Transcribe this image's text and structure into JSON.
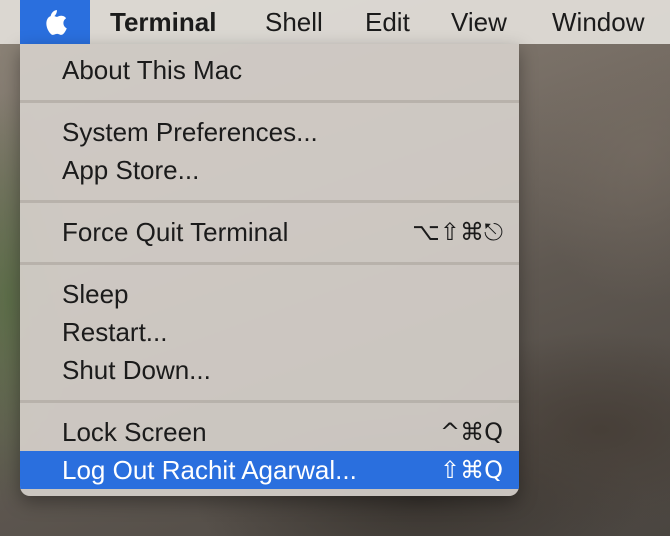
{
  "menubar": {
    "apple_icon": "apple-logo-icon",
    "app_name": "Terminal",
    "menus": [
      "Shell",
      "Edit",
      "View",
      "Window"
    ]
  },
  "apple_menu": {
    "items": {
      "about": "About This Mac",
      "system_preferences": "System Preferences...",
      "app_store": "App Store...",
      "force_quit": "Force Quit Terminal",
      "force_quit_shortcut": "⌥⇧⌘⎋",
      "sleep": "Sleep",
      "restart": "Restart...",
      "shut_down": "Shut Down...",
      "lock_screen": "Lock Screen",
      "lock_screen_shortcut": "^⌘Q",
      "log_out": "Log Out Rachit Agarwal...",
      "log_out_shortcut": "⇧⌘Q"
    },
    "highlighted_item": "log_out"
  },
  "colors": {
    "accent": "#2a6fde",
    "menu_bg": "#d4cfc9",
    "text": "#1b1b1b"
  }
}
